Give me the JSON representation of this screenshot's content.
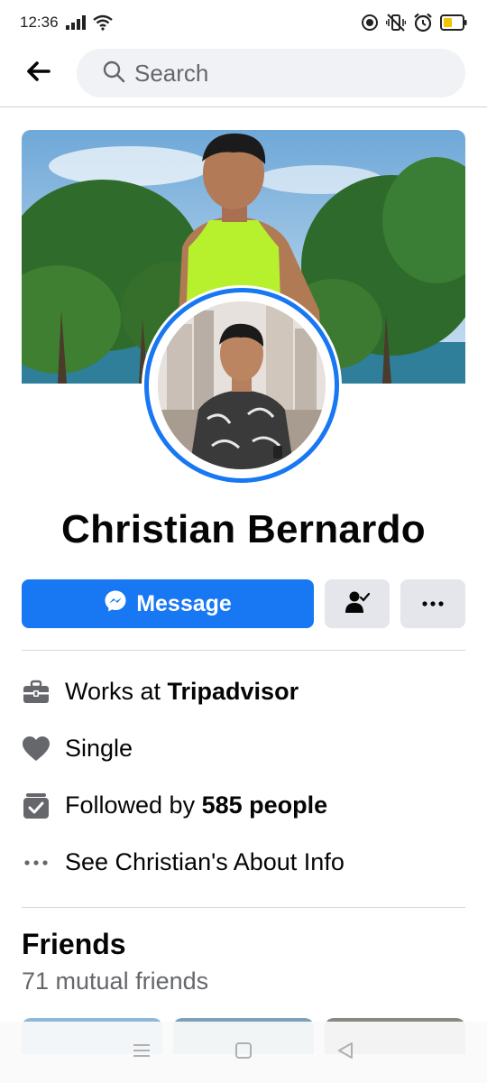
{
  "status_bar": {
    "time": "12:36",
    "icons": [
      "signal-icon",
      "wifi-icon",
      "record-icon",
      "vibrate-icon",
      "alarm-icon",
      "battery-icon"
    ],
    "battery_color": "#f5c400"
  },
  "top_nav": {
    "back_icon": "arrow-left-icon",
    "search_placeholder": "Search",
    "search_value": ""
  },
  "profile": {
    "name": "Christian Bernardo",
    "accent_color": "#1877f2"
  },
  "actions": {
    "message_label": "Message",
    "message_icon": "messenger-icon",
    "friend_icon": "friends-check-icon",
    "more_icon": "more-dots-icon"
  },
  "details": [
    {
      "icon": "briefcase-icon",
      "prefix": "Works at ",
      "bold": "Tripadvisor"
    },
    {
      "icon": "heart-icon",
      "prefix": "Single",
      "bold": ""
    },
    {
      "icon": "followers-icon",
      "prefix": "Followed by ",
      "bold": "585 people"
    },
    {
      "icon": "more-dots-icon",
      "prefix": "See Christian's About Info",
      "bold": ""
    }
  ],
  "friends": {
    "title": "Friends",
    "mutual": "71 mutual friends"
  },
  "android_nav": {
    "icons": [
      "menu-icon",
      "home-square-icon",
      "back-triangle-icon"
    ]
  }
}
